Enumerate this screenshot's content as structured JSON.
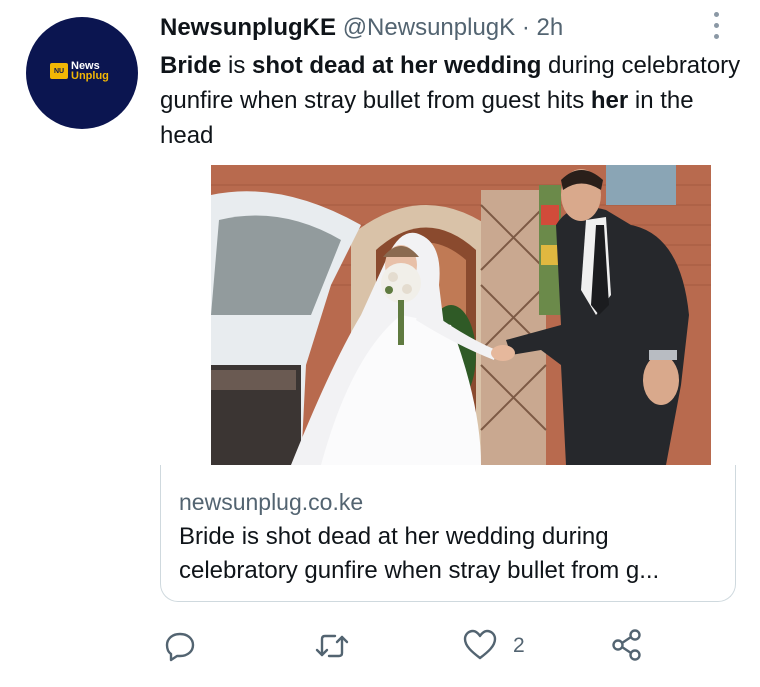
{
  "tweet": {
    "display_name": "NewsunplugKE",
    "handle": "@NewsunplugK",
    "separator": "·",
    "time": "2h",
    "text_parts": {
      "p1": "Bride",
      "p2": " is ",
      "p3": "shot dead at her wedding",
      "p4": " during celebratory gunfire when stray bullet from guest hits ",
      "p5": "her",
      "p6": " in the head"
    }
  },
  "avatar": {
    "logo_mark": "NU",
    "logo_line1": "News",
    "logo_line2": "Unplug"
  },
  "card": {
    "domain": "newsunplug.co.ke",
    "title": "Bride is shot dead at her wedding during celebratory gunfire when stray bullet from g..."
  },
  "actions": {
    "reply_icon": "reply-icon",
    "retweet_icon": "retweet-icon",
    "like_icon": "heart-icon",
    "like_count": "2",
    "share_icon": "share-icon"
  },
  "colors": {
    "avatar_bg": "#0b1550",
    "text": "#0f1419",
    "muted": "#536471",
    "border": "#cfd9de"
  }
}
